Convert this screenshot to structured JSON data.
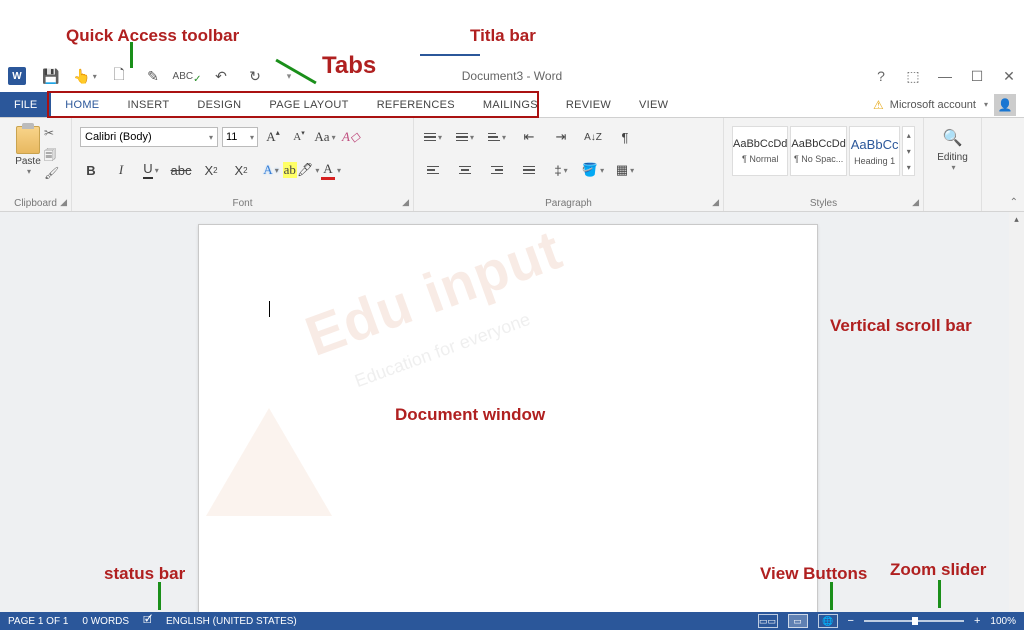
{
  "annotations": {
    "qat": "Quick Access toolbar",
    "tabs": "Tabs",
    "title_bar": "Titla bar",
    "doc_window": "Document window",
    "vscroll": "Vertical scroll bar",
    "status_bar": "status bar",
    "view_buttons": "View Buttons",
    "zoom_slider": "Zoom slider"
  },
  "title": "Document3 - Word",
  "account": {
    "label": "Microsoft account"
  },
  "file_tab": "FILE",
  "tabs": [
    {
      "label": "HOME",
      "active": true
    },
    {
      "label": "INSERT"
    },
    {
      "label": "DESIGN"
    },
    {
      "label": "PAGE LAYOUT"
    },
    {
      "label": "REFERENCES"
    },
    {
      "label": "MAILINGS"
    },
    {
      "label": "REVIEW"
    },
    {
      "label": "VIEW"
    }
  ],
  "ribbon": {
    "clipboard": {
      "label": "Clipboard",
      "paste": "Paste"
    },
    "font": {
      "label": "Font",
      "name": "Calibri (Body)",
      "size": "11"
    },
    "paragraph": {
      "label": "Paragraph"
    },
    "styles": {
      "label": "Styles",
      "items": [
        {
          "sample": "AaBbCcDd",
          "name": "¶ Normal"
        },
        {
          "sample": "AaBbCcDd",
          "name": "¶ No Spac..."
        },
        {
          "sample": "AaBbCc",
          "name": "Heading 1",
          "blue": true
        }
      ]
    },
    "editing": {
      "label": "Editing"
    }
  },
  "status": {
    "page": "PAGE 1 OF 1",
    "words": "0 WORDS",
    "language": "ENGLISH (UNITED STATES)",
    "zoom": "100%"
  },
  "watermark": {
    "main": "Edu input",
    "sub": "Education for everyone"
  }
}
